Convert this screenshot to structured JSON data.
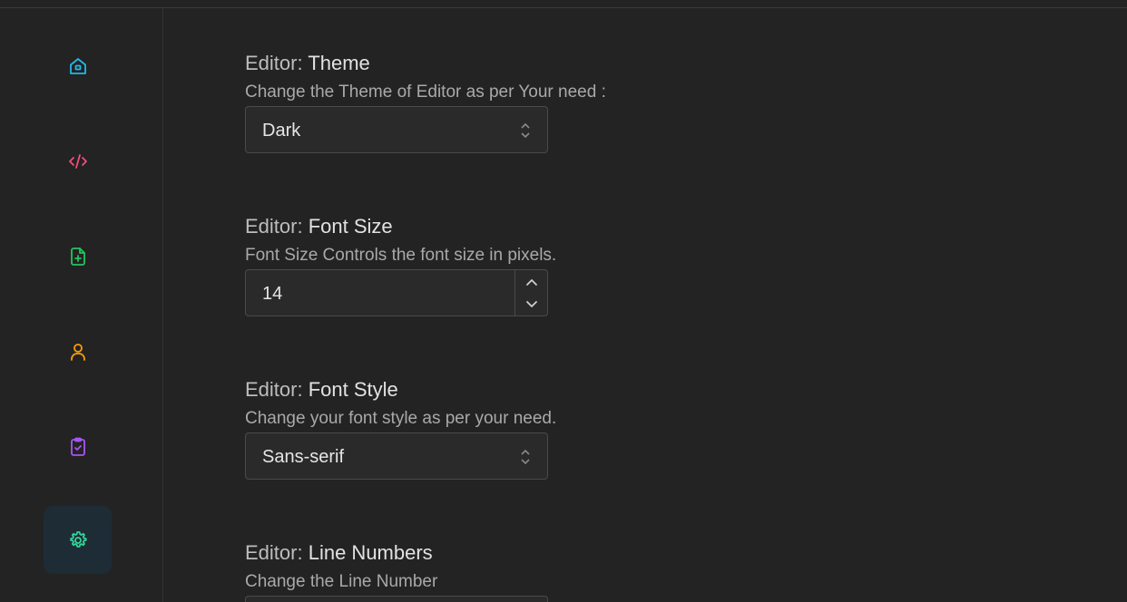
{
  "sidebar": {
    "items": [
      {
        "icon": "home-icon",
        "color": "#22b8e6",
        "active": false
      },
      {
        "icon": "code-icon",
        "color": "#f0507a",
        "active": false
      },
      {
        "icon": "file-plus-icon",
        "color": "#22c55e",
        "active": false
      },
      {
        "icon": "user-icon",
        "color": "#f59e0b",
        "active": false
      },
      {
        "icon": "clipboard-check-icon",
        "color": "#a855f7",
        "active": false
      },
      {
        "icon": "gear-icon",
        "color": "#34d399",
        "active": true
      }
    ]
  },
  "settings": {
    "theme": {
      "prefix": "Editor:",
      "title": "Theme",
      "description": "Change the Theme of Editor as per Your need :",
      "value": "Dark"
    },
    "font_size": {
      "prefix": "Editor:",
      "title": "Font Size",
      "description": "Font Size Controls the font size in pixels.",
      "value": "14"
    },
    "font_style": {
      "prefix": "Editor:",
      "title": "Font Style",
      "description": "Change your font style as per your need.",
      "value": "Sans-serif"
    },
    "line_numbers": {
      "prefix": "Editor:",
      "title": "Line Numbers",
      "description": "Change the Line Number"
    }
  }
}
